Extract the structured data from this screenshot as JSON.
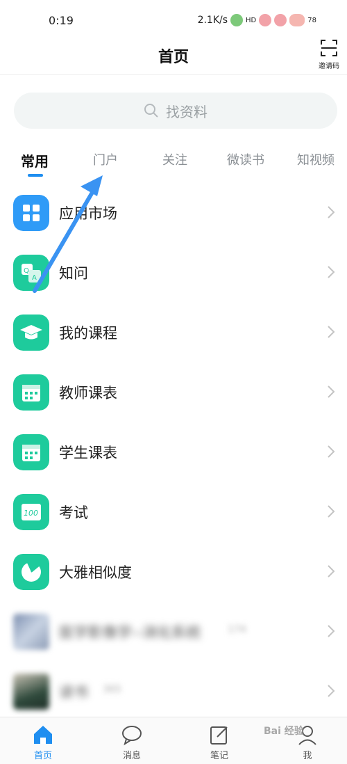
{
  "status_bar": {
    "time": "0:19",
    "network_speed": "2.1K/s",
    "hd_label": "HD",
    "battery": "78"
  },
  "header": {
    "title": "首页",
    "invite_label": "邀请码",
    "invite_icon": "scan-icon"
  },
  "search": {
    "placeholder": "找资料",
    "icon": "search-icon"
  },
  "tabs": [
    {
      "label": "常用",
      "active": true
    },
    {
      "label": "门户",
      "active": false
    },
    {
      "label": "关注",
      "active": false
    },
    {
      "label": "微读书",
      "active": false
    },
    {
      "label": "知视频",
      "active": false
    }
  ],
  "list": {
    "items": [
      {
        "label": "应用市场",
        "icon": "app-grid-icon",
        "color": "#2f9bf7"
      },
      {
        "label": "知问",
        "icon": "qa-icon",
        "color": "#1ecb9c"
      },
      {
        "label": "我的课程",
        "icon": "graduation-cap-icon",
        "color": "#1ecb9c"
      },
      {
        "label": "教师课表",
        "icon": "calendar-icon",
        "color": "#1ecb9c"
      },
      {
        "label": "学生课表",
        "icon": "calendar-icon",
        "color": "#1ecb9c"
      },
      {
        "label": "考试",
        "icon": "exam-100-icon",
        "color": "#1ecb9c"
      },
      {
        "label": "大雅相似度",
        "icon": "pie-icon",
        "color": "#1ecb9c"
      },
      {
        "label": "医学影像学--消化系统",
        "badge": "174",
        "icon": "thumbnail",
        "blurred": true
      },
      {
        "label": "读书",
        "badge": "365",
        "icon": "thumbnail",
        "blurred": true
      }
    ]
  },
  "bottom_nav": [
    {
      "label": "首页",
      "icon": "home-icon",
      "active": true
    },
    {
      "label": "消息",
      "icon": "message-icon",
      "active": false
    },
    {
      "label": "笔记",
      "icon": "note-icon",
      "active": false
    },
    {
      "label": "我",
      "icon": "person-icon",
      "active": false
    }
  ],
  "watermark": "Bai 经验",
  "colors": {
    "accent": "#1f8ef0",
    "green": "#1ecb9c",
    "blue": "#2f9bf7",
    "annotation": "#3a93f2"
  }
}
